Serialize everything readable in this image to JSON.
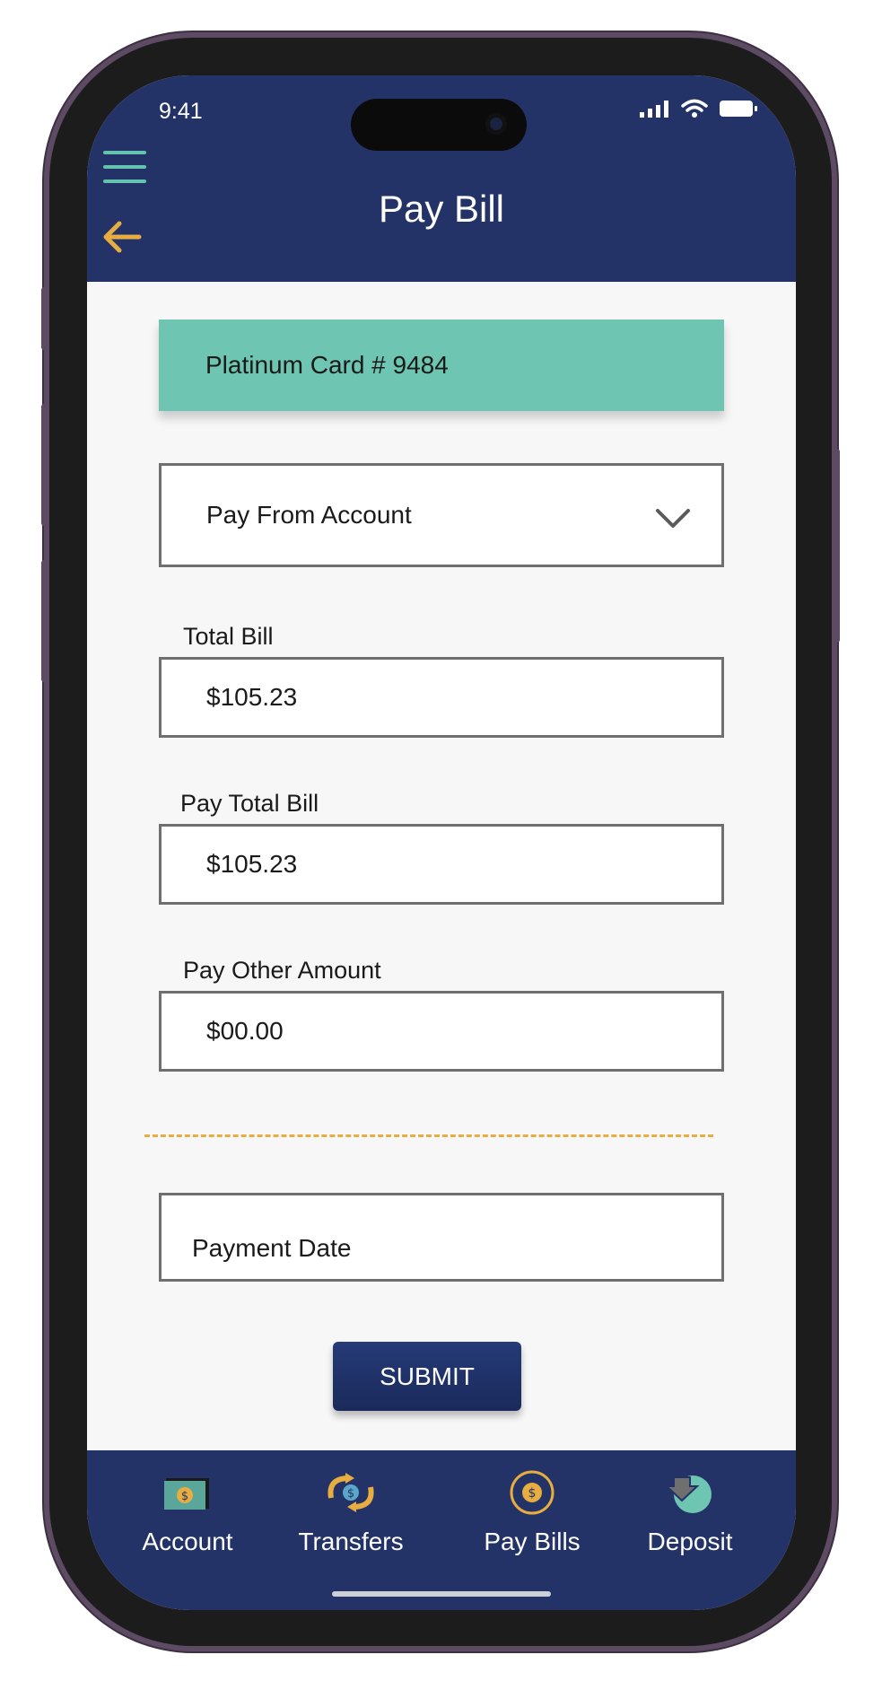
{
  "status_bar": {
    "time": "9:41"
  },
  "header": {
    "title": "Pay Bill"
  },
  "card": {
    "label": "Platinum Card # 9484"
  },
  "pay_from": {
    "label": "Pay From Account"
  },
  "total_bill": {
    "label": "Total Bill",
    "value": "$105.23"
  },
  "pay_total_bill": {
    "label": "Pay Total Bill",
    "value": "$105.23"
  },
  "pay_other_amount": {
    "label": "Pay Other Amount",
    "value": "$00.00"
  },
  "payment_date": {
    "placeholder": "Payment Date"
  },
  "submit": {
    "label": "SUBMIT"
  },
  "tabs": [
    {
      "label": "Account",
      "icon": "wallet-icon"
    },
    {
      "label": "Transfers",
      "icon": "transfer-icon"
    },
    {
      "label": "Pay Bills",
      "icon": "dollar-coin-icon"
    },
    {
      "label": "Deposit",
      "icon": "deposit-icon"
    }
  ],
  "colors": {
    "header_bg": "#233367",
    "accent_teal": "#6ec5b2",
    "accent_orange": "#e7ad40",
    "screen_bg": "#f7f7f7"
  }
}
